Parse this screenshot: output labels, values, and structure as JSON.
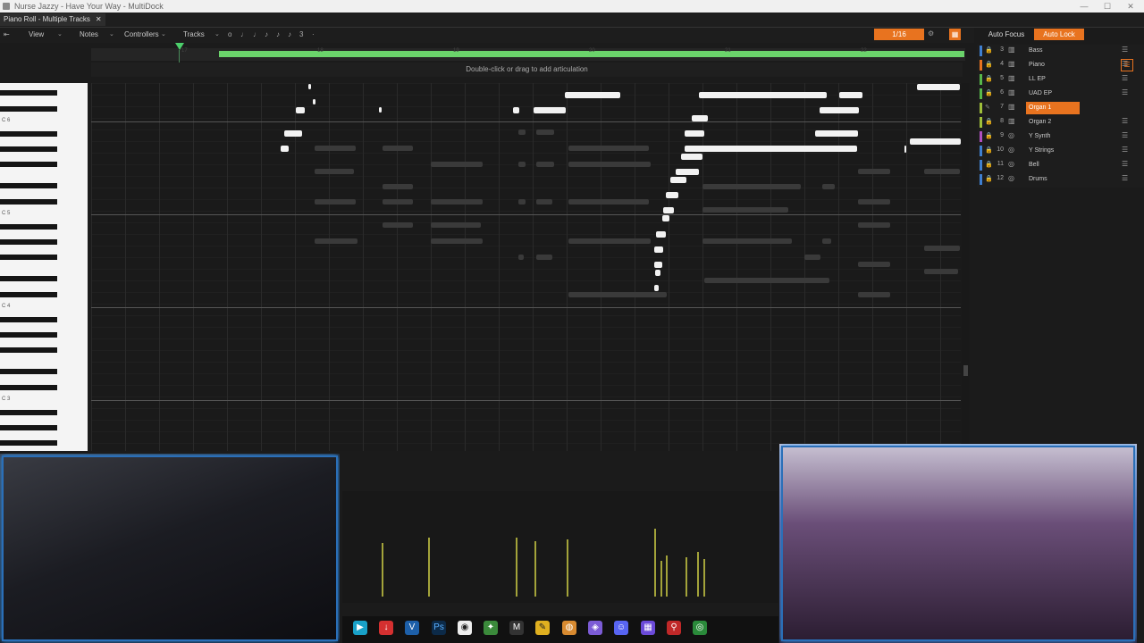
{
  "window": {
    "title": "Nurse Jazzy - Have Your Way - MultiDock"
  },
  "tab": {
    "label": "Piano Roll - Multiple Tracks",
    "close": "✕"
  },
  "toolbar": {
    "view": "View",
    "notes": "Notes",
    "controllers": "Controllers",
    "tracks": "Tracks",
    "step": "3",
    "quantize": "1/16",
    "auto_focus": "Auto Focus",
    "auto_lock": "Auto Lock"
  },
  "ruler": {
    "bars": [
      "17",
      "18",
      "19",
      "20",
      "21",
      "22"
    ]
  },
  "articulation_hint": "Double-click or drag to add articulation",
  "keyboard": {
    "octaves": [
      "C 6",
      "C 5",
      "C 4",
      "C 3"
    ]
  },
  "tracks": [
    {
      "num": "3",
      "name": "Bass",
      "color": "#3f7fd0",
      "icon": "piano-icon",
      "selected": false
    },
    {
      "num": "4",
      "name": "Piano",
      "color": "#e8731f",
      "icon": "piano-icon",
      "selected": false
    },
    {
      "num": "5",
      "name": "LL EP",
      "color": "#58b84a",
      "icon": "piano-icon",
      "selected": false
    },
    {
      "num": "6",
      "name": "UAD EP",
      "color": "#58b84a",
      "icon": "piano-icon",
      "selected": false
    },
    {
      "num": "7",
      "name": "Organ 1",
      "color": "#9fbf3a",
      "icon": "piano-icon",
      "selected": true
    },
    {
      "num": "8",
      "name": "Organ 2",
      "color": "#9fbf3a",
      "icon": "piano-icon",
      "selected": false
    },
    {
      "num": "9",
      "name": "Y Synth",
      "color": "#b050c0",
      "icon": "synth-icon",
      "selected": false
    },
    {
      "num": "10",
      "name": "Y Strings",
      "color": "#3f7fd0",
      "icon": "synth-icon",
      "selected": false
    },
    {
      "num": "11",
      "name": "Bell",
      "color": "#3f7fd0",
      "icon": "synth-icon",
      "selected": false
    },
    {
      "num": "12",
      "name": "Drums",
      "color": "#3f7fd0",
      "icon": "synth-icon",
      "selected": false
    }
  ],
  "colors": {
    "accent": "#e8731f",
    "loop": "#6bd36b",
    "playhead": "#4ccf6b",
    "velocity": "#a3a33a"
  },
  "taskbar_icons": [
    "play-app-icon",
    "download-app-icon",
    "v-app-icon",
    "photoshop-icon",
    "obs-icon",
    "chat-icon",
    "mail-icon",
    "notes-icon",
    "browser-icon",
    "audio-icon",
    "discord-icon",
    "grid-app-icon",
    "maps-icon",
    "record-icon"
  ]
}
